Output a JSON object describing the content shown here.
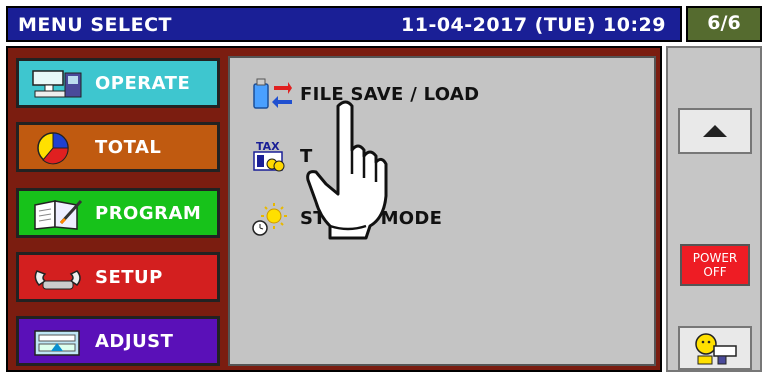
{
  "header": {
    "title": "MENU SELECT",
    "datetime": "11-04-2017 (TUE)  10:29",
    "page_indicator": "6/6"
  },
  "menu": [
    {
      "id": "operate",
      "label": "OPERATE",
      "color": "#3ec6cf",
      "icon": "scale-icon"
    },
    {
      "id": "total",
      "label": "TOTAL",
      "color": "#c05a10",
      "icon": "pie-chart-icon"
    },
    {
      "id": "program",
      "label": "PROGRAM",
      "color": "#17c21a",
      "icon": "book-icon"
    },
    {
      "id": "setup",
      "label": "SETUP",
      "color": "#d31f1f",
      "icon": "wrench-icon"
    },
    {
      "id": "adjust",
      "label": "ADJUST",
      "color": "#5a10b8",
      "icon": "keyboard-icon"
    }
  ],
  "content_items": [
    {
      "label": "FILE SAVE / LOAD",
      "icon": "usb-transfer-icon"
    },
    {
      "label": "T",
      "icon": "tax-icon"
    },
    {
      "label": "ST   DBY MODE",
      "icon": "standby-sun-icon"
    }
  ],
  "rail": {
    "power_line1": "POWER",
    "power_line2": "OFF",
    "up_icon": "triangle-up-icon",
    "bottom_icon": "operator-icon"
  }
}
